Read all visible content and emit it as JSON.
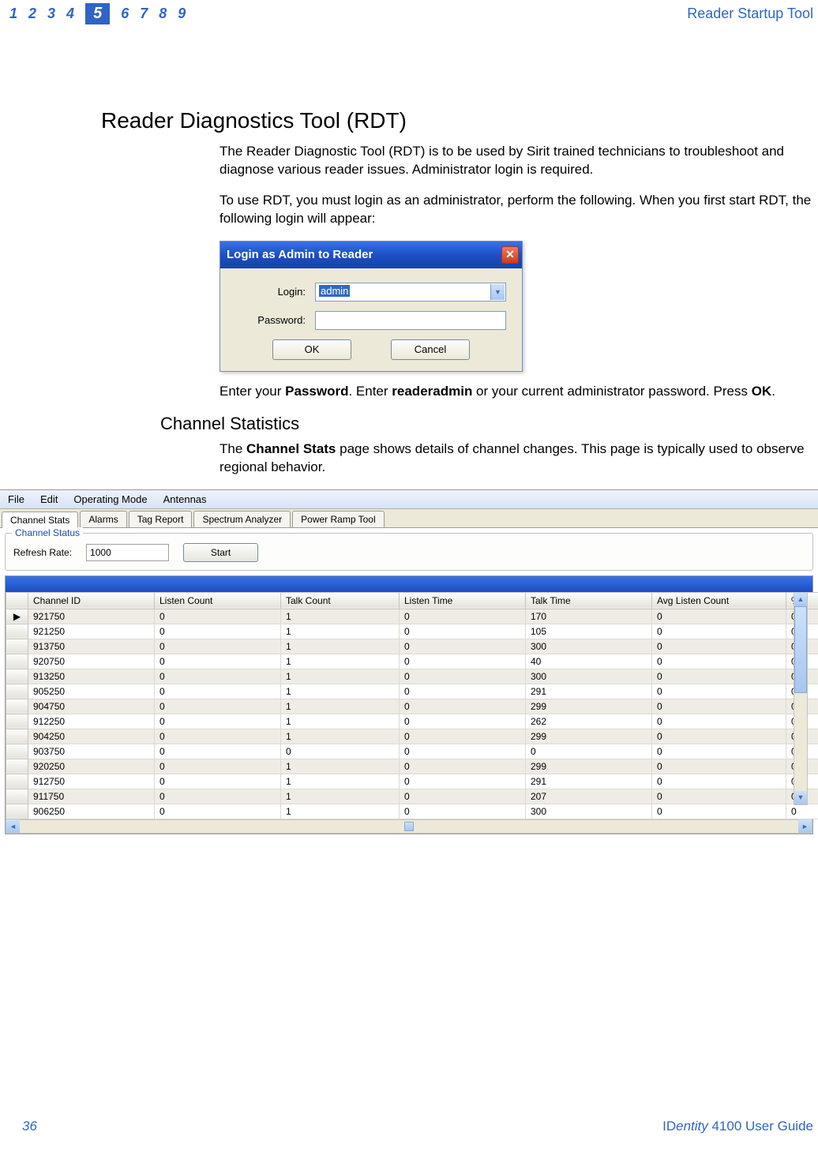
{
  "header": {
    "chapters": [
      "1",
      "2",
      "3",
      "4",
      "5",
      "6",
      "7",
      "8",
      "9"
    ],
    "active_chapter": "5",
    "title": "Reader Startup Tool"
  },
  "section": {
    "title": "Reader Diagnostics Tool (RDT)",
    "para1": "The Reader Diagnostic Tool (RDT) is to be used by Sirit trained technicians to troubleshoot and diagnose various reader issues. Administrator login is required.",
    "para2": "To use RDT, you must login as an administrator, perform the following. When you first start RDT, the following login will appear:",
    "para3_pre": "Enter your ",
    "para3_b1": "Password",
    "para3_mid": ". Enter ",
    "para3_b2": "readeradmin",
    "para3_post": " or your current administrator password. Press ",
    "para3_b3": "OK",
    "para3_end": "."
  },
  "login_dialog": {
    "title": "Login as Admin to Reader",
    "login_label": "Login:",
    "login_value": "admin",
    "password_label": "Password:",
    "ok_label": "OK",
    "cancel_label": "Cancel"
  },
  "subsection": {
    "title": "Channel Statistics",
    "para_pre": "The ",
    "para_b": "Channel Stats",
    "para_post": " page shows details of channel changes. This page is typically used to observe regional behavior."
  },
  "rdt_app": {
    "menus": [
      "File",
      "Edit",
      "Operating Mode",
      "Antennas"
    ],
    "tabs": [
      "Channel Stats",
      "Alarms",
      "Tag Report",
      "Spectrum Analyzer",
      "Power Ramp Tool"
    ],
    "active_tab": "Channel Stats",
    "groupbox_title": "Channel Status",
    "refresh_label": "Refresh Rate:",
    "refresh_value": "1000",
    "start_label": "Start",
    "columns": [
      "Channel ID",
      "Listen Count",
      "Talk Count",
      "Listen Time",
      "Talk Time",
      "Avg Listen Count",
      "% L"
    ],
    "rows": [
      [
        "921750",
        "0",
        "1",
        "0",
        "170",
        "0",
        "0"
      ],
      [
        "921250",
        "0",
        "1",
        "0",
        "105",
        "0",
        "0"
      ],
      [
        "913750",
        "0",
        "1",
        "0",
        "300",
        "0",
        "0"
      ],
      [
        "920750",
        "0",
        "1",
        "0",
        "40",
        "0",
        "0"
      ],
      [
        "913250",
        "0",
        "1",
        "0",
        "300",
        "0",
        "0"
      ],
      [
        "905250",
        "0",
        "1",
        "0",
        "291",
        "0",
        "0"
      ],
      [
        "904750",
        "0",
        "1",
        "0",
        "299",
        "0",
        "0"
      ],
      [
        "912250",
        "0",
        "1",
        "0",
        "262",
        "0",
        "0"
      ],
      [
        "904250",
        "0",
        "1",
        "0",
        "299",
        "0",
        "0"
      ],
      [
        "903750",
        "0",
        "0",
        "0",
        "0",
        "0",
        "0"
      ],
      [
        "920250",
        "0",
        "1",
        "0",
        "299",
        "0",
        "0"
      ],
      [
        "912750",
        "0",
        "1",
        "0",
        "291",
        "0",
        "0"
      ],
      [
        "911750",
        "0",
        "1",
        "0",
        "207",
        "0",
        "0"
      ],
      [
        "906250",
        "0",
        "1",
        "0",
        "300",
        "0",
        "0"
      ]
    ]
  },
  "footer": {
    "page_num": "36",
    "guide_brand": "IDentity",
    "guide_rest": " 4100 User Guide"
  }
}
